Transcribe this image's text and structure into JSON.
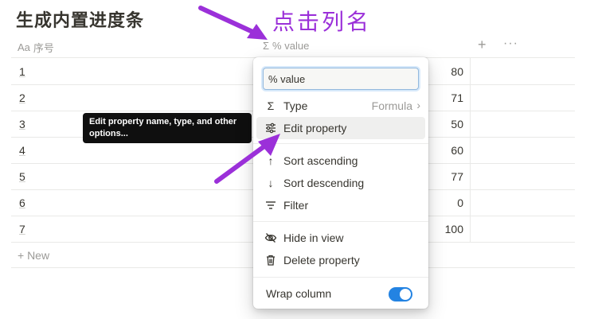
{
  "page": {
    "title": "生成内置进度条"
  },
  "annotation": {
    "instruction": "点击列名",
    "color": "#9b30d9"
  },
  "table": {
    "columns": [
      {
        "icon": "Aa",
        "label": "序号"
      },
      {
        "icon": "Σ",
        "label": "% value"
      }
    ],
    "add_column": "+",
    "more": "···",
    "rows": [
      {
        "num": "1",
        "value": "80"
      },
      {
        "num": "2",
        "value": "71"
      },
      {
        "num": "3",
        "value": "50"
      },
      {
        "num": "4",
        "value": "60"
      },
      {
        "num": "5",
        "value": "77"
      },
      {
        "num": "6",
        "value": "0"
      },
      {
        "num": "7",
        "value": "100"
      }
    ],
    "new_row": "+ New"
  },
  "tooltip": {
    "text": "Edit property name, type, and other options..."
  },
  "menu": {
    "name_input": "% value",
    "type": {
      "label": "Type",
      "value": "Formula",
      "icon": "sigma-icon"
    },
    "edit": {
      "label": "Edit property",
      "icon": "sliders-icon"
    },
    "sort_asc": {
      "label": "Sort ascending",
      "icon": "arrow-up-icon"
    },
    "sort_desc": {
      "label": "Sort descending",
      "icon": "arrow-down-icon"
    },
    "filter": {
      "label": "Filter",
      "icon": "filter-icon"
    },
    "hide": {
      "label": "Hide in view",
      "icon": "eye-slash-icon"
    },
    "delete": {
      "label": "Delete property",
      "icon": "trash-icon"
    },
    "wrap": {
      "label": "Wrap column",
      "enabled": true
    },
    "accent": "#2383e2"
  }
}
